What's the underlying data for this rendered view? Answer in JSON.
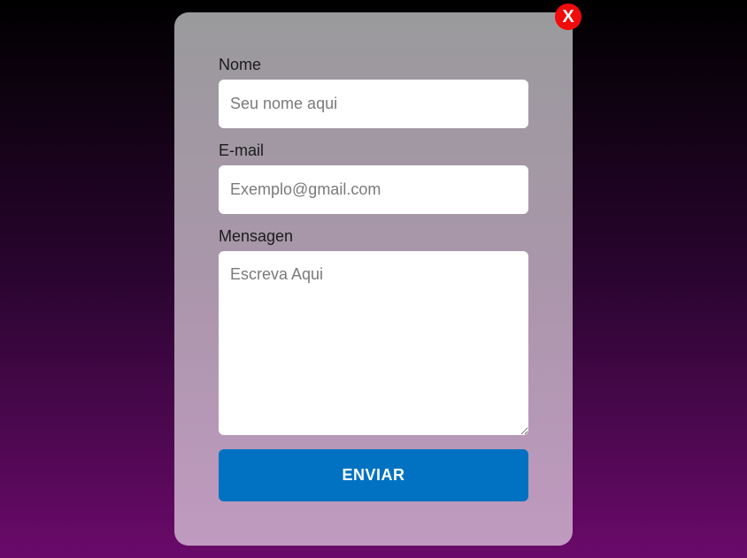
{
  "modal": {
    "close_label": "X",
    "fields": {
      "name": {
        "label": "Nome",
        "placeholder": "Seu nome aqui",
        "value": ""
      },
      "email": {
        "label": "E-mail",
        "placeholder": "Exemplo@gmail.com",
        "value": ""
      },
      "message": {
        "label": "Mensagen",
        "placeholder": "Escreva Aqui",
        "value": ""
      }
    },
    "submit_label": "ENVIAR"
  },
  "colors": {
    "submit_button": "#0172c2",
    "close_button": "#f10b0b",
    "background_top": "#000000",
    "background_bottom": "#6a0a6a",
    "modal_top": "#9a9a9c",
    "modal_bottom": "#c09ac0"
  }
}
